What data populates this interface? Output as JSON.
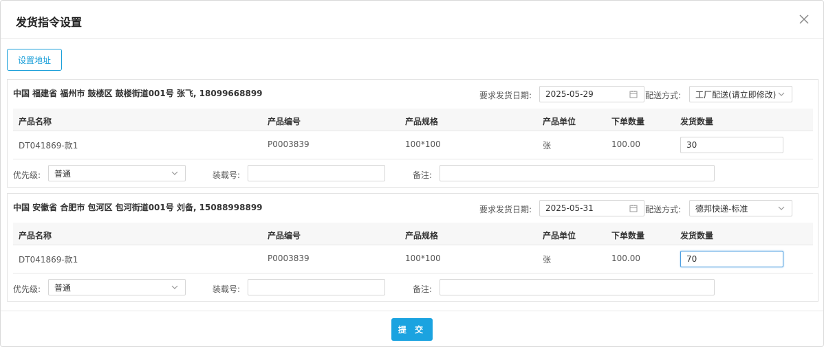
{
  "dialog": {
    "title": "发货指令设置"
  },
  "set_address_label": "设置地址",
  "labels": {
    "ship_date": "要求发货日期:",
    "delivery": "配送方式:",
    "priority": "优先级:",
    "loading": "装载号:",
    "remark": "备注:"
  },
  "columns": [
    "产品名称",
    "产品编号",
    "产品规格",
    "产品单位",
    "下单数量",
    "发货数量"
  ],
  "orders": [
    {
      "address": "中国 福建省 福州市 鼓楼区 鼓楼街道001号 张飞, 18099668899",
      "ship_date": "2025-05-29",
      "delivery": "工厂配送(请立即修改)",
      "row": {
        "name": "DT041869-款1",
        "code": "P0003839",
        "spec": "100*100",
        "unit": "张",
        "qty": "100.00",
        "ship_qty": "30"
      },
      "priority": "普通",
      "loading_no": "",
      "remark": ""
    },
    {
      "address": "中国 安徽省 合肥市 包河区 包河街道001号 刘备, 15088998899",
      "ship_date": "2025-05-31",
      "delivery": "德邦快递-标准",
      "row": {
        "name": "DT041869-款1",
        "code": "P0003839",
        "spec": "100*100",
        "unit": "张",
        "qty": "100.00",
        "ship_qty": "70"
      },
      "priority": "普通",
      "loading_no": "",
      "remark": ""
    }
  ],
  "submit_label": "提 交"
}
